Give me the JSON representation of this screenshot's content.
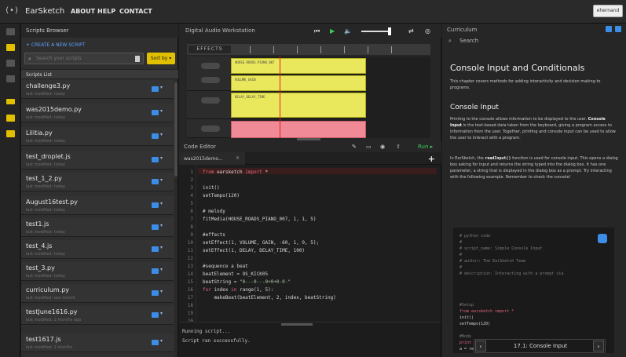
{
  "topbar": {
    "logo": "(•)",
    "brand": "EarSketch",
    "nav": [
      "ABOUT",
      "HELP",
      "CONTACT"
    ],
    "user": "ehernand"
  },
  "browser": {
    "title": "Scripts Browser",
    "create": "+ CREATE A NEW SCRIPT",
    "search_placeholder": "Search your scripts",
    "sort_label": "Sort by ▾",
    "list_title": "Scripts List",
    "scripts": [
      {
        "name": "challenge3.py",
        "sub": "last modified: today"
      },
      {
        "name": "was2015demo.py",
        "sub": "last modified: today"
      },
      {
        "name": "Lilitia.py",
        "sub": "last modified: today"
      },
      {
        "name": "test_droplet.js",
        "sub": "last modified: today"
      },
      {
        "name": "test_1_2.py",
        "sub": "last modified: today"
      },
      {
        "name": "August16test.py",
        "sub": "last modified: today"
      },
      {
        "name": "test1.js",
        "sub": "last modified: today"
      },
      {
        "name": "test_4.js",
        "sub": "last modified: today"
      },
      {
        "name": "test_3.py",
        "sub": "last modified: today"
      },
      {
        "name": "curriculum.py",
        "sub": "last modified: last month"
      },
      {
        "name": "testJune1616.py",
        "sub": "last modified: 2 months ago"
      },
      {
        "name": "test1617.js",
        "sub": "last modified: 2 months"
      }
    ]
  },
  "daw": {
    "title": "Digital Audio Workstation",
    "effects_label": "EFFECTS",
    "clip_labels": [
      "HOUSE_ROADS_PIANO_007",
      "VOLUME_GAIN",
      "DELAY_DELAY_TIME"
    ]
  },
  "editor": {
    "title": "Code Editor",
    "tab": "was2015demo...",
    "run_label": "Run ▸",
    "lines": [
      "from earsketch import *",
      "",
      "init()",
      "setTempo(120)",
      "",
      "# melody",
      "fitMedia(HOUSE_ROADS_PIANO_007, 1, 1, 5)",
      "",
      "#effects",
      "setEffect(1, VOLUME, GAIN, -60, 1, 0, 5);",
      "setEffect(1, DELAY, DELAY_TIME, 100)",
      "",
      "#sequence a beat",
      "beatElement = OS_KICK05",
      "beatString = \"0---0---0+0+0-0-\"",
      "for index in range(1, 5):",
      "    makeBeat(beatElement, 2, index, beatString)"
    ]
  },
  "console": {
    "lines": [
      "Running script...",
      "Script ran successfully."
    ]
  },
  "curriculum": {
    "title": "Curriculum",
    "search": "Search",
    "h1": "Console Input and Conditionals",
    "intro": "This chapter covers methods for adding interactivity and decision making to programs.",
    "h2": "Console Input",
    "para1_a": "Printing to the console allows information to be displayed to the user.",
    "para1_b": "Console Input",
    "para1_c": "is the text-based data taken from the keyboard, giving a program access to information from the user. Together, printing and console input can be used to allow the user to interact with a program.",
    "para2_a": "In EarSketch, the",
    "para2_b": "readInput()",
    "para2_c": "function is used for console input. This opens a dialog box asking for input and returns the string typed into the dialog box. It has one parameter, a string that is displayed in the dialog box as a prompt. Try interacting with the following example. Remember to check the console!",
    "code": [
      "# python code",
      "#",
      "# script_name: Simple Console Input",
      "#",
      "# author: The EarSketch Team",
      "#",
      "# description: Interacting with a prompt via",
      "",
      "",
      "",
      "",
      "#Setup",
      "from earsketch import *",
      "init()",
      "setTempo(120)",
      "",
      "#Body",
      "print 'Hello.'",
      "a = readInput('What is your name?')"
    ],
    "pager_label": "17.1: Console Input"
  }
}
